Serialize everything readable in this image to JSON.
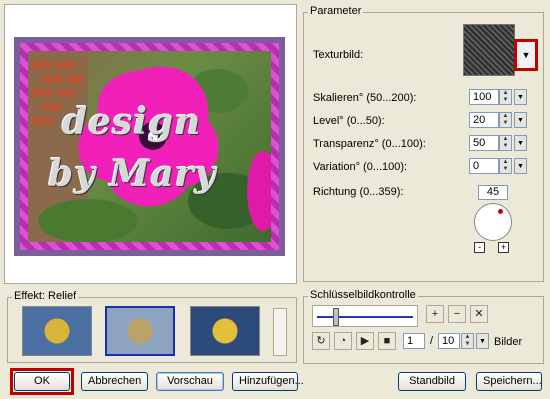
{
  "preview": {
    "watermark_line1": "design",
    "watermark_line2": "by Mary"
  },
  "effect": {
    "label": "Effekt: Relief"
  },
  "parameter": {
    "group_label": "Parameter",
    "texturbild_label": "Texturbild:",
    "fields": [
      {
        "label": "Skalieren° (50...200):",
        "value": "100"
      },
      {
        "label": "Level° (0...50):",
        "value": "20"
      },
      {
        "label": "Transparenz° (0...100):",
        "value": "50"
      },
      {
        "label": "Variation° (0...100):",
        "value": "0"
      }
    ],
    "richtung_label": "Richtung (0...359):",
    "richtung_value": "45",
    "minus": "-",
    "plus": "+"
  },
  "keyframe": {
    "group_label": "Schlüsselbildkontrolle",
    "current_frame": "1",
    "separator": "/",
    "total_frames": "10",
    "unit": "Bilder"
  },
  "buttons": {
    "ok": "OK",
    "cancel": "Abbrechen",
    "preview": "Vorschau",
    "add": "Hinzufügen...",
    "still": "Standbild",
    "save": "Speichern..."
  }
}
